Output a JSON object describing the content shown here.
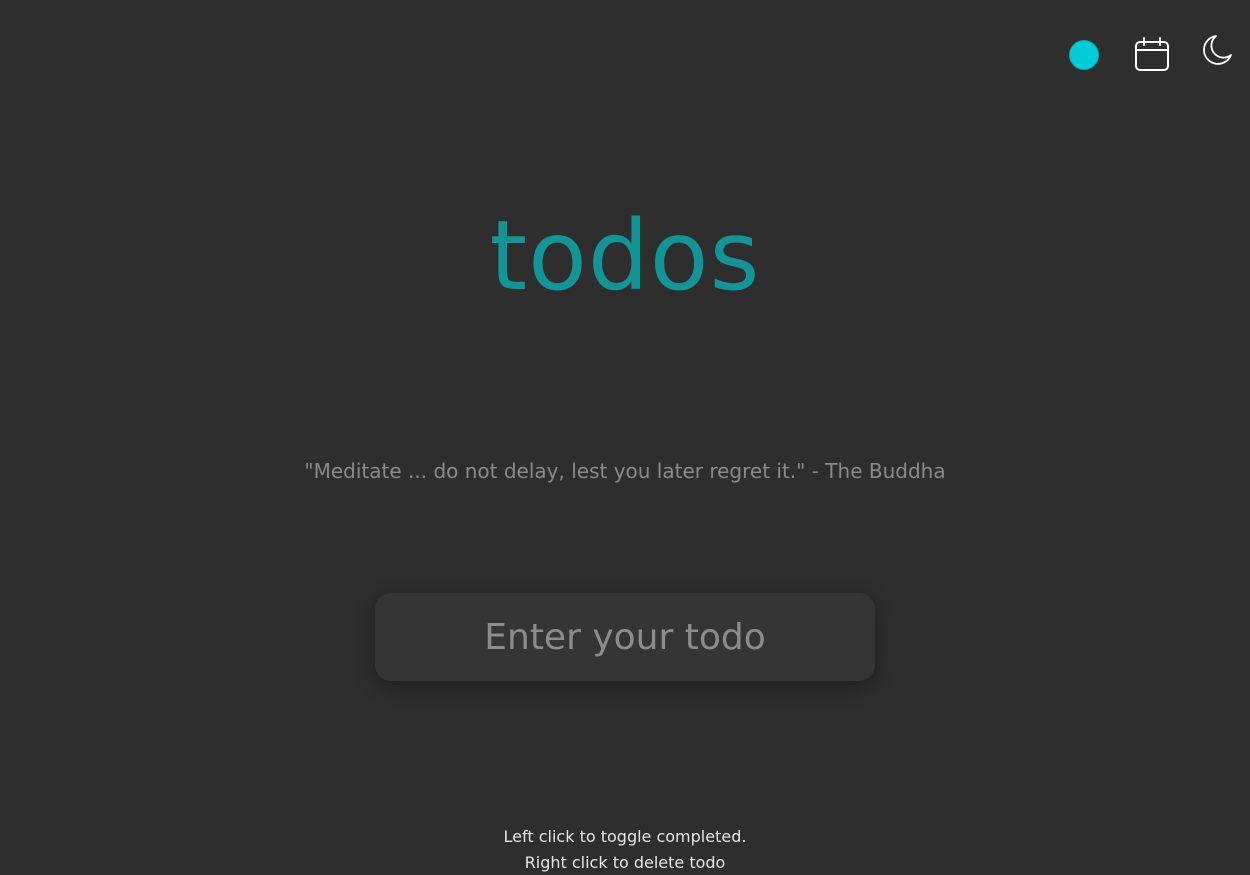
{
  "toolbar": {
    "color_picker": {
      "icon": "color-dot",
      "color": "#00cdd6"
    },
    "calendar": {
      "icon": "calendar-icon"
    },
    "theme_toggle": {
      "icon": "moon-icon"
    }
  },
  "title": "todos",
  "quote": "\"Meditate ... do not delay, lest you later regret it.\" - The Buddha",
  "input": {
    "placeholder": "Enter your todo",
    "value": ""
  },
  "help": {
    "line1": "Left click to toggle completed.",
    "line2": "Right click to delete todo"
  },
  "colors": {
    "background": "#2e2e2e",
    "accent": "#139497",
    "quote_text": "#8a8a8a",
    "input_bg": "#353535"
  }
}
